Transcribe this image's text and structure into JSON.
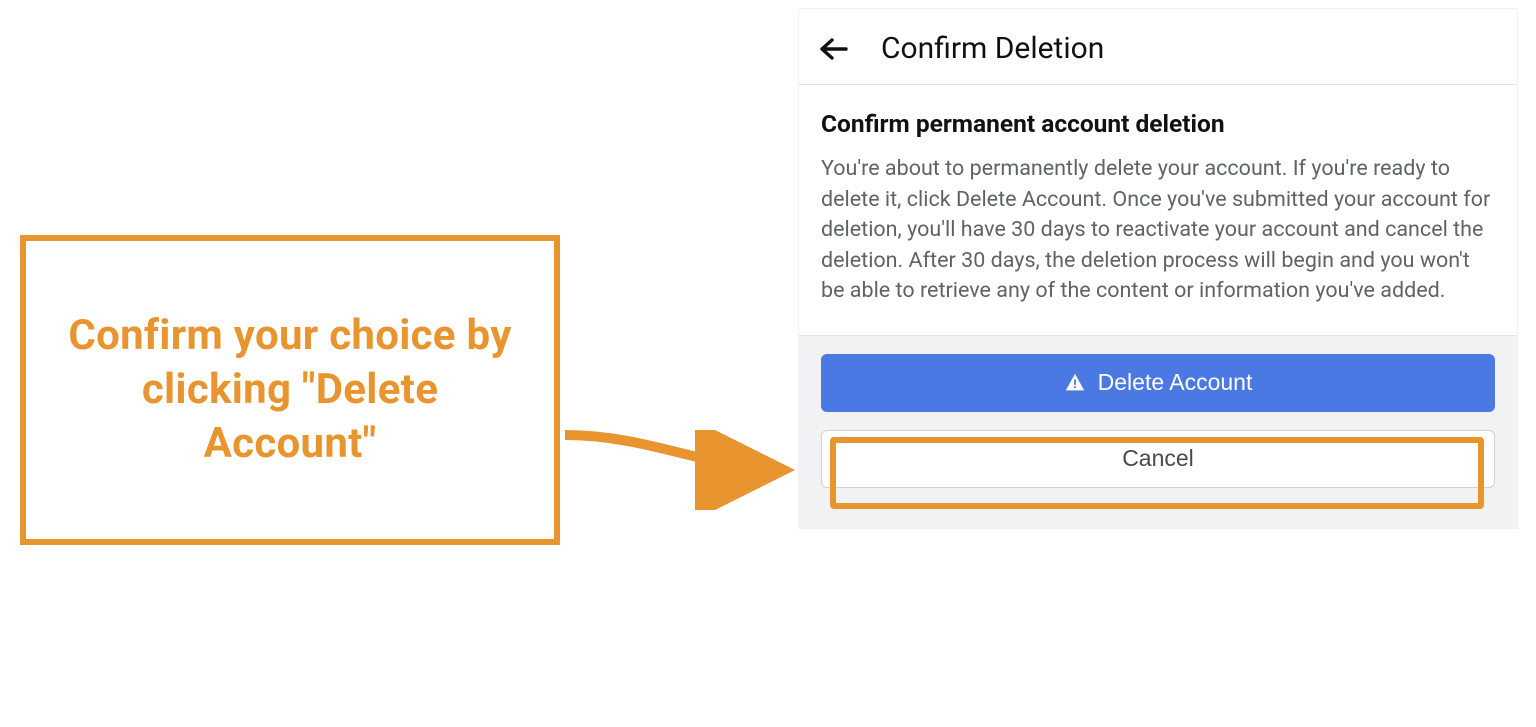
{
  "callout": {
    "text": "Confirm your choice by clicking \"Delete Account\""
  },
  "panel": {
    "title": "Confirm Deletion",
    "heading": "Confirm permanent account deletion",
    "body": "You're about to permanently delete your account. If you're ready to delete it, click Delete Account. Once you've submitted your account for deletion, you'll have 30 days to reactivate your account and cancel the deletion. After 30 days, the deletion process will begin and you won't be able to retrieve any of the content or information you've added.",
    "primary_button": "Delete Account",
    "secondary_button": "Cancel"
  },
  "colors": {
    "accent_orange": "#e8942f",
    "primary_blue": "#4b79e4"
  }
}
